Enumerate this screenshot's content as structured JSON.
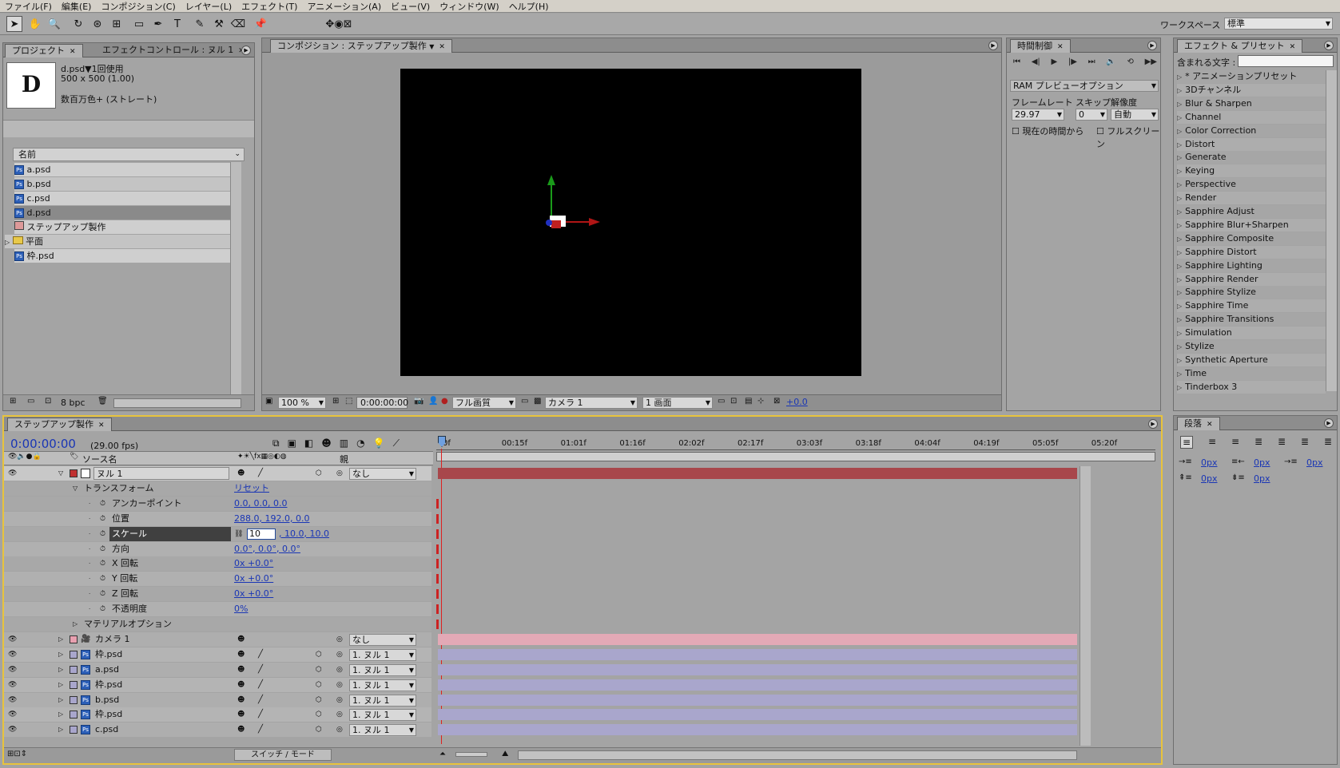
{
  "menu": [
    "ファイル(F)",
    "編集(E)",
    "コンポジション(C)",
    "レイヤー(L)",
    "エフェクト(T)",
    "アニメーション(A)",
    "ビュー(V)",
    "ウィンドウ(W)",
    "ヘルプ(H)"
  ],
  "workspace": {
    "label": "ワークスペース :",
    "value": "標準"
  },
  "project": {
    "tabs": [
      "プロジェクト",
      "エフェクトコントロール : ヌル 1"
    ],
    "thumb_letter": "D",
    "info": {
      "name": "d.psd▼1回使用",
      "dims": "500 x 500 (1.00)",
      "color": "数百万色+ (ストレート)"
    },
    "column_header": "名前",
    "items": [
      {
        "name": "a.psd",
        "type": "psd"
      },
      {
        "name": "b.psd",
        "type": "psd"
      },
      {
        "name": "c.psd",
        "type": "psd"
      },
      {
        "name": "d.psd",
        "type": "psd"
      },
      {
        "name": "ステップアップ製作",
        "type": "comp"
      },
      {
        "name": "平面",
        "type": "folder"
      },
      {
        "name": "枠.psd",
        "type": "psd"
      }
    ],
    "bpc": "8 bpc"
  },
  "comp": {
    "tab": "コンポジション : ステップアップ製作",
    "zoom": "100 %",
    "timecode": "0:00:00:00",
    "quality": "フル画質",
    "camera": "カメラ 1",
    "view": "1 画面",
    "exposure": "+0.0"
  },
  "time_control": {
    "tab": "時間制御",
    "ram_preview": "RAM プレビューオプション",
    "labels": {
      "framerate": "フレームレート",
      "skip": "スキップ",
      "resolution": "解像度"
    },
    "values": {
      "framerate": "29.97",
      "skip": "0",
      "resolution": "自動"
    },
    "checks": {
      "from_current": "現在の時間から",
      "fullscreen": "フルスクリーン"
    }
  },
  "effects": {
    "tab": "エフェクト & プリセット",
    "search_label": "含まれる文字 :",
    "items": [
      "* アニメーションプリセット",
      "3Dチャンネル",
      "Blur & Sharpen",
      "Channel",
      "Color Correction",
      "Distort",
      "Generate",
      "Keying",
      "Perspective",
      "Render",
      "Sapphire Adjust",
      "Sapphire Blur+Sharpen",
      "Sapphire Composite",
      "Sapphire Distort",
      "Sapphire Lighting",
      "Sapphire Render",
      "Sapphire Stylize",
      "Sapphire Time",
      "Sapphire Transitions",
      "Simulation",
      "Stylize",
      "Synthetic Aperture",
      "Time",
      "Tinderbox 3"
    ]
  },
  "paragraph": {
    "tab": "段落",
    "values": [
      "0px",
      "0px",
      "0px",
      "0px",
      "0px"
    ]
  },
  "timeline": {
    "tab": "ステップアップ製作",
    "timecode": "0:00:00:00",
    "fps": "(29.00 fps)",
    "col_source": "ソース名",
    "col_parent": "親",
    "ruler": [
      "0f",
      "00:15f",
      "01:01f",
      "01:16f",
      "02:02f",
      "02:17f",
      "03:03f",
      "03:18f",
      "04:04f",
      "04:19f",
      "05:05f",
      "05:20f"
    ],
    "layers_top": {
      "name": "ヌル 1",
      "parent": "なし"
    },
    "transform_label": "トランスフォーム",
    "reset": "リセット",
    "props": [
      {
        "name": "アンカーポイント",
        "value": "0.0, 0.0, 0.0"
      },
      {
        "name": "位置",
        "value": "288.0, 192.0, 0.0"
      },
      {
        "name": "スケール",
        "value": "10",
        "value2": ", 10.0, 10.0"
      },
      {
        "name": "方向",
        "value": "0.0°, 0.0°, 0.0°"
      },
      {
        "name": "X 回転",
        "value": "0x +0.0°"
      },
      {
        "name": "Y 回転",
        "value": "0x +0.0°"
      },
      {
        "name": "Z 回転",
        "value": "0x +0.0°"
      },
      {
        "name": "不透明度",
        "value": "0%"
      }
    ],
    "material": "マテリアルオプション",
    "layers": [
      {
        "name": "カメラ 1",
        "parent": "なし",
        "type": "camera"
      },
      {
        "name": "枠.psd",
        "parent": "1. ヌル 1",
        "type": "psd"
      },
      {
        "name": "a.psd",
        "parent": "1. ヌル 1",
        "type": "psd"
      },
      {
        "name": "枠.psd",
        "parent": "1. ヌル 1",
        "type": "psd"
      },
      {
        "name": "b.psd",
        "parent": "1. ヌル 1",
        "type": "psd"
      },
      {
        "name": "枠.psd",
        "parent": "1. ヌル 1",
        "type": "psd"
      },
      {
        "name": "c.psd",
        "parent": "1. ヌル 1",
        "type": "psd"
      }
    ],
    "switch_mode": "スイッチ / モード"
  },
  "colors": {
    "null_bar": "#a8474b",
    "camera_bar": "#e3a9b6",
    "psd_bar": "#a9a6cc",
    "accent_blue": "#1a36b5"
  }
}
